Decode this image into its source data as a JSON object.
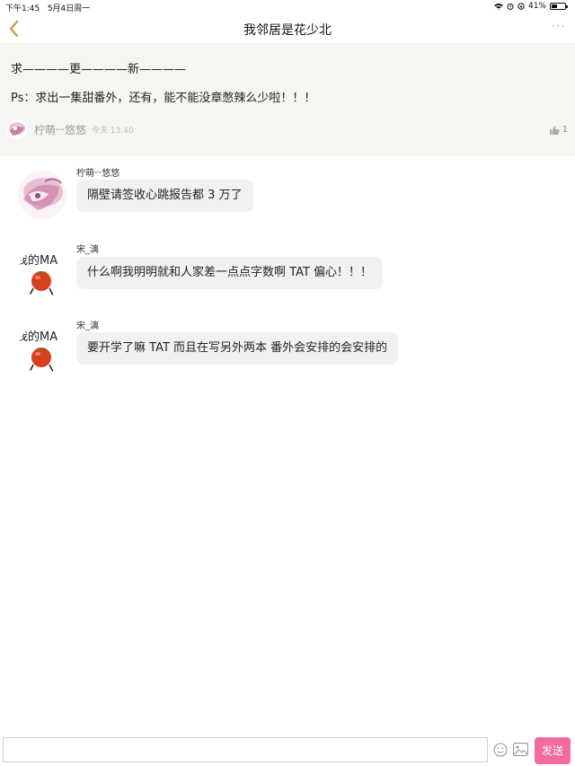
{
  "status_bar": {
    "time": "下午1:45",
    "date": "5月4日周一",
    "battery_text": "41%",
    "battery_level": 0.41
  },
  "nav": {
    "title": "我邻居是花少北",
    "more_label": "···"
  },
  "post": {
    "line1": "求————更————新————",
    "line2": "Ps：求出一集甜番外，还有，能不能没章憋辣么少啦！！！",
    "author": "柠萌ᵕᵕ悠悠",
    "time": "今天 13:40",
    "like_count": "1"
  },
  "comments": [
    {
      "name": "柠萌ᵕᵕ悠悠",
      "text": "隔壁请签收心跳报告都 3 万了",
      "avatar": "pink-sketch"
    },
    {
      "name": "宋_漓",
      "text": "什么啊我明明就和人家差一点点字数啊 TAT 偏心！！！",
      "avatar": "tomato",
      "avatar_text": "我的MA"
    },
    {
      "name": "宋_漓",
      "text": "要开学了嘛 TAT 而且在写另外两本 番外会安排的会安排的",
      "avatar": "tomato",
      "avatar_text": "我的MA"
    }
  ],
  "input": {
    "placeholder": "",
    "send_label": "发送"
  },
  "colors": {
    "accent": "#f36b9d",
    "back_arrow": "#c8a04a",
    "post_bg": "#f5f5f1",
    "bubble_bg": "#f1f1f3"
  }
}
